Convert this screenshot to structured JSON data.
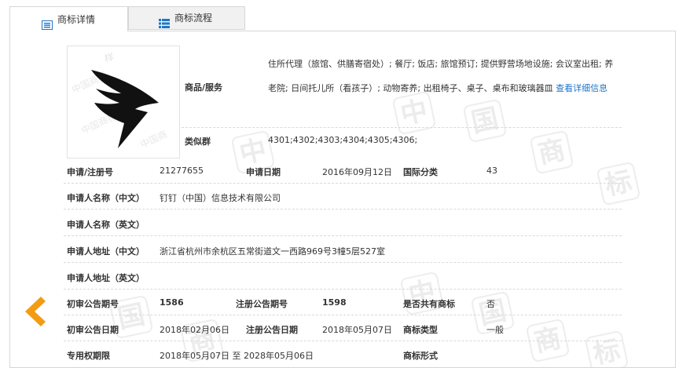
{
  "tabs": [
    {
      "label": "商标详情",
      "icon": "document-list-icon"
    },
    {
      "label": "商标流程",
      "icon": "process-list-icon"
    }
  ],
  "trademark": {
    "logo_icon": "dingtalk-logo",
    "goods_label": "商品/服务",
    "goods_text": "住所代理（旅馆、供膳寄宿处）; 餐厅; 饭店; 旅馆预订; 提供野营场地设施; 会议室出租; 养老院; 日间托儿所（看孩子）; 动物寄养; 出租椅子、桌子、桌布和玻璃器皿",
    "goods_more_link": "查看详细信息",
    "similar_group_label": "类似群",
    "similar_group_value": "4301;4302;4303;4304;4305;4306;"
  },
  "fields": {
    "reg_no_label": "申请/注册号",
    "reg_no_value": "21277655",
    "apply_date_label": "申请日期",
    "apply_date_value": "2016年09月12日",
    "intl_class_label": "国际分类",
    "intl_class_value": "43",
    "applicant_cn_label": "申请人名称（中文）",
    "applicant_cn_value": "钉钉（中国）信息技术有限公司",
    "applicant_en_label": "申请人名称（英文）",
    "applicant_en_value": "",
    "address_cn_label": "申请人地址（中文）",
    "address_cn_value": "浙江省杭州市余杭区五常街道文一西路969号3幢5层527室",
    "address_en_label": "申请人地址（英文）",
    "address_en_value": "",
    "prelim_no_label": "初审公告期号",
    "prelim_no_value": "1586",
    "reg_pub_no_label": "注册公告期号",
    "reg_pub_no_value": "1598",
    "shared_label": "是否共有商标",
    "shared_value": "否",
    "prelim_date_label": "初审公告日期",
    "prelim_date_value": "2018年02月06日",
    "reg_pub_date_label": "注册公告日期",
    "reg_pub_date_value": "2018年05月07日",
    "tm_type_label": "商标类型",
    "tm_type_value": "一般",
    "exclusive_label": "专用权期限",
    "exclusive_value": "2018年05月07日 至 2028年05月06日",
    "tm_form_label": "商标形式",
    "tm_form_value": ""
  },
  "nav": {
    "prev_icon": "chevron-left-icon"
  },
  "colors": {
    "accent": "#1f76c8",
    "arrow": "#f39c12"
  },
  "watermark": "中国商标"
}
